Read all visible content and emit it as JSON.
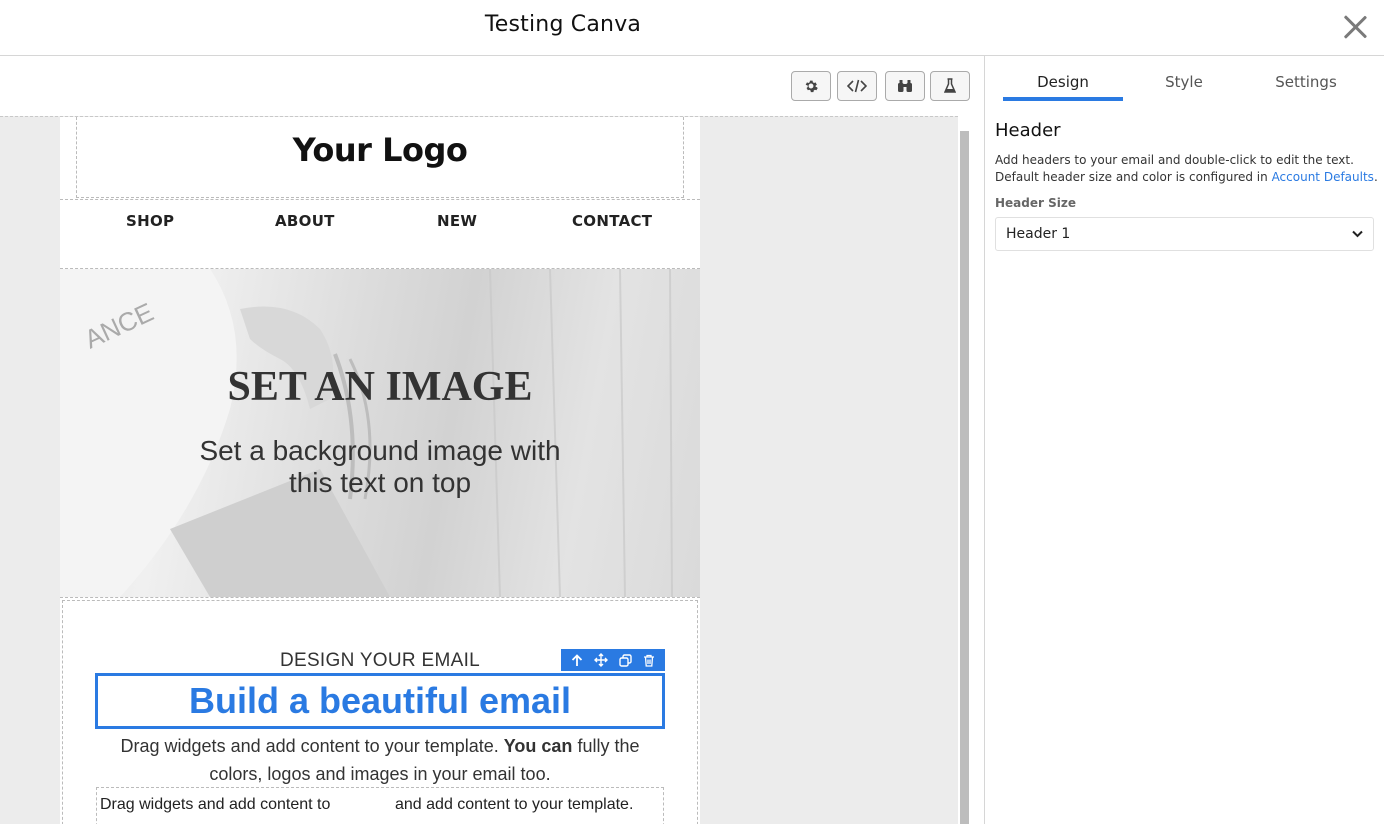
{
  "app": {
    "title": "Testing Canva"
  },
  "toolbar": {
    "icons": [
      "gear-icon",
      "code-icon",
      "binoculars-icon",
      "flask-icon"
    ]
  },
  "email": {
    "logo": "Your Logo",
    "nav": [
      "SHOP",
      "ABOUT",
      "NEW",
      "CONTACT"
    ],
    "hero": {
      "heading": "SET AN IMAGE",
      "text": "Set a background image with this text on top"
    },
    "eyebrow": "DESIGN YOUR EMAIL",
    "headline": "Build a beautiful email",
    "para_pre": "Drag widgets and add content to your template. ",
    "para_bold": "You can",
    "para_post": " fully the colors, logos and images in your email too.",
    "col_left": "Drag widgets and add content to",
    "col_right": "and add content to your template."
  },
  "widget_toolbar": {
    "icons": [
      "arrow-up-icon",
      "move-icon",
      "duplicate-icon",
      "trash-icon"
    ]
  },
  "panel": {
    "tabs": [
      "Design",
      "Style",
      "Settings"
    ],
    "active_tab": "Design",
    "section_title": "Header",
    "description": "Add headers to your email and double-click to edit the text. Default header size and color is configured in ",
    "link": "Account Defaults",
    "desc_end": ".",
    "field_label": "Header Size",
    "field_value": "Header 1"
  },
  "colors": {
    "accent": "#2a7ae2"
  }
}
